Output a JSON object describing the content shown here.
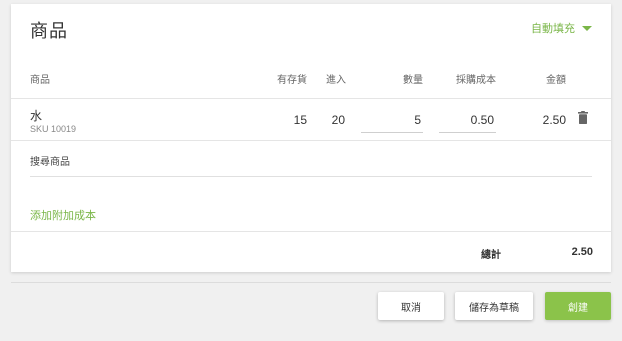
{
  "card": {
    "title": "商品",
    "autofill_label": "自動填充"
  },
  "table": {
    "headers": {
      "product": "商品",
      "in_stock": "有存貨",
      "incoming": "進入",
      "quantity": "數量",
      "purchase_cost": "採購成本",
      "amount": "金額"
    },
    "rows": [
      {
        "name": "水",
        "sku": "SKU 10019",
        "in_stock": "15",
        "incoming": "20",
        "quantity": "5",
        "purchase_cost": "0.50",
        "amount": "2.50"
      }
    ]
  },
  "search": {
    "label": "搜尋商品"
  },
  "add_cost_label": "添加附加成本",
  "total": {
    "label": "總計",
    "value": "2.50"
  },
  "actions": {
    "cancel": "取消",
    "save_draft": "儲存為草稿",
    "create": "創建"
  },
  "colors": {
    "accent_green": "#7ab648",
    "button_green": "#8bc34a"
  }
}
